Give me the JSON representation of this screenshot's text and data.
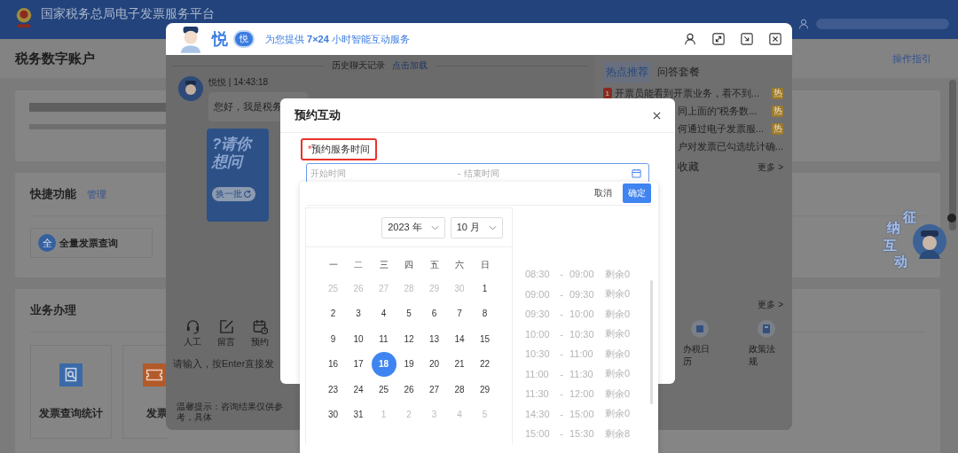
{
  "page": {
    "title": "国家税务总局电子发票服务平台",
    "account_title": "税务数字账户",
    "guide_link": "操作指引",
    "shortcuts": {
      "title": "快捷功能",
      "manage_link": "管理",
      "items": [
        {
          "icon_text": "全",
          "label": "全量发票查询"
        }
      ]
    },
    "business": {
      "title": "业务办理",
      "items": [
        {
          "kind": "search",
          "label": "发票查询统计"
        },
        {
          "kind": "ticket",
          "label": "发票"
        }
      ]
    },
    "float_badge": {
      "chars": [
        "征",
        "纳",
        "互",
        "动"
      ]
    }
  },
  "chat": {
    "brand": "悦",
    "brand_badge": "悦",
    "tagline": "为您提供 **7×24** 小时智能互动服务",
    "history": {
      "label": "历史聊天记录",
      "link": "点击加载"
    },
    "message": {
      "sender": "悦悦 | 14:43:18",
      "text": "您好，我是税务"
    },
    "promo": {
      "lines": [
        "?请你",
        "想问"
      ],
      "button": "换一批"
    },
    "tools": [
      {
        "kind": "headset",
        "label": "人工"
      },
      {
        "kind": "edit",
        "label": "留言"
      },
      {
        "kind": "calendar",
        "label": "预约"
      }
    ],
    "input": {
      "placeholder": "请输入，按Enter直接发"
    },
    "hint": "温馨提示：咨询结果仅供参考，具体",
    "side": {
      "tabs": [
        {
          "label": "热点推荐",
          "selected": true
        },
        {
          "label": "问答套餐",
          "selected": false
        }
      ],
      "hot_items": [
        {
          "rank": "1",
          "text": "开票员能看到开票业务，看不到...",
          "badge": "热"
        },
        {
          "text": "同上面的“税务数...",
          "badge": "热"
        },
        {
          "text": "何通过电子发票服...",
          "badge": "热"
        },
        {
          "text": "户对发票已勾选统计确..."
        }
      ],
      "favorites": {
        "title": "收藏",
        "more": "更多 >"
      },
      "services": {
        "more": "更多 >",
        "items": [
          {
            "kind": "calendar",
            "label": "办税日历"
          },
          {
            "kind": "book",
            "label": "政策法规"
          }
        ]
      }
    }
  },
  "modal": {
    "title": "预约互动",
    "field": {
      "required": true,
      "required_mark": "*",
      "label": "预约服务时间",
      "highlighted": true,
      "start_placeholder": "开始时间",
      "separator": "-",
      "end_placeholder": "结束时间"
    }
  },
  "picker": {
    "cancel": "取消",
    "confirm": "确定",
    "year": "2023 年",
    "month": "10 月",
    "weekdays": [
      "一",
      "二",
      "三",
      "四",
      "五",
      "六",
      "日"
    ],
    "days": [
      {
        "label": "25",
        "outside": true,
        "selected": false
      },
      {
        "label": "26",
        "outside": true,
        "selected": false
      },
      {
        "label": "27",
        "outside": true,
        "selected": false
      },
      {
        "label": "28",
        "outside": true,
        "selected": false
      },
      {
        "label": "29",
        "outside": true,
        "selected": false
      },
      {
        "label": "30",
        "outside": true,
        "selected": false
      },
      {
        "label": "1",
        "outside": false,
        "selected": false
      },
      {
        "label": "2",
        "outside": false,
        "selected": false
      },
      {
        "label": "3",
        "outside": false,
        "selected": false
      },
      {
        "label": "4",
        "outside": false,
        "selected": false
      },
      {
        "label": "5",
        "outside": false,
        "selected": false
      },
      {
        "label": "6",
        "outside": false,
        "selected": false
      },
      {
        "label": "7",
        "outside": false,
        "selected": false
      },
      {
        "label": "8",
        "outside": false,
        "selected": false
      },
      {
        "label": "9",
        "outside": false,
        "selected": false
      },
      {
        "label": "10",
        "outside": false,
        "selected": false
      },
      {
        "label": "11",
        "outside": false,
        "selected": false
      },
      {
        "label": "12",
        "outside": false,
        "selected": false
      },
      {
        "label": "13",
        "outside": false,
        "selected": false
      },
      {
        "label": "14",
        "outside": false,
        "selected": false
      },
      {
        "label": "15",
        "outside": false,
        "selected": false
      },
      {
        "label": "16",
        "outside": false,
        "selected": false
      },
      {
        "label": "17",
        "outside": false,
        "selected": false
      },
      {
        "label": "18",
        "outside": false,
        "selected": true
      },
      {
        "label": "19",
        "outside": false,
        "selected": false
      },
      {
        "label": "20",
        "outside": false,
        "selected": false
      },
      {
        "label": "21",
        "outside": false,
        "selected": false
      },
      {
        "label": "22",
        "outside": false,
        "selected": false
      },
      {
        "label": "23",
        "outside": false,
        "selected": false
      },
      {
        "label": "24",
        "outside": false,
        "selected": false
      },
      {
        "label": "25",
        "outside": false,
        "selected": false
      },
      {
        "label": "26",
        "outside": false,
        "selected": false
      },
      {
        "label": "27",
        "outside": false,
        "selected": false
      },
      {
        "label": "28",
        "outside": false,
        "selected": false
      },
      {
        "label": "29",
        "outside": false,
        "selected": false
      },
      {
        "label": "30",
        "outside": false,
        "selected": false
      },
      {
        "label": "31",
        "outside": false,
        "selected": false
      },
      {
        "label": "1",
        "outside": true,
        "selected": false
      },
      {
        "label": "2",
        "outside": true,
        "selected": false
      },
      {
        "label": "3",
        "outside": true,
        "selected": false
      },
      {
        "label": "4",
        "outside": true,
        "selected": false
      },
      {
        "label": "5",
        "outside": true,
        "selected": false
      }
    ],
    "slots": [
      {
        "start": "08:30",
        "separator": "-",
        "end": "09:00",
        "remaining": "剩余0",
        "disabled": true
      },
      {
        "start": "09:00",
        "separator": "-",
        "end": "09:30",
        "remaining": "剩余0",
        "disabled": true
      },
      {
        "start": "09:30",
        "separator": "-",
        "end": "10:00",
        "remaining": "剩余0",
        "disabled": true
      },
      {
        "start": "10:00",
        "separator": "-",
        "end": "10:30",
        "remaining": "剩余0",
        "disabled": true
      },
      {
        "start": "10:30",
        "separator": "-",
        "end": "11:00",
        "remaining": "剩余0",
        "disabled": true
      },
      {
        "start": "11:00",
        "separator": "-",
        "end": "11:30",
        "remaining": "剩余0",
        "disabled": true
      },
      {
        "start": "11:30",
        "separator": "-",
        "end": "12:00",
        "remaining": "剩余0",
        "disabled": true
      },
      {
        "start": "14:30",
        "separator": "-",
        "end": "15:00",
        "remaining": "剩余0",
        "disabled": true
      },
      {
        "start": "15:00",
        "separator": "-",
        "end": "15:30",
        "remaining": "剩余8",
        "disabled": true
      }
    ]
  }
}
